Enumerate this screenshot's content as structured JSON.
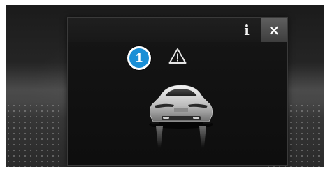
{
  "toolbar": {
    "info_label": "i",
    "close_label": "×"
  },
  "callout": {
    "number": "1"
  },
  "icons": {
    "warning": "warning-triangle-icon",
    "car": "car-rear-view-icon",
    "info": "info-icon",
    "close": "close-icon"
  },
  "colors": {
    "callout_fill": "#1a8fd6",
    "panel_bg": "#121212",
    "close_bg": "#4a4a4a"
  }
}
